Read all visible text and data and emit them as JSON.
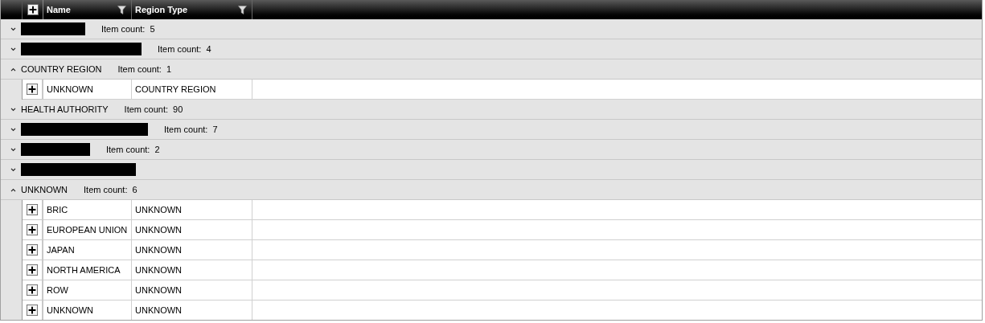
{
  "grid": {
    "columns": [
      {
        "label": "Name"
      },
      {
        "label": "Region Type"
      }
    ],
    "groups": [
      {
        "redacted": true,
        "count": "Item count:  5",
        "expanded": false
      },
      {
        "redacted": true,
        "count": "Item count:  4",
        "expanded": false
      },
      {
        "redacted": false,
        "label": "COUNTRY REGION",
        "count": "Item count:  1",
        "expanded": true,
        "rows": [
          {
            "name": "UNKNOWN",
            "region_type": "COUNTRY REGION"
          }
        ]
      },
      {
        "redacted": false,
        "label": "HEALTH AUTHORITY",
        "count": "Item count:  90",
        "expanded": false
      },
      {
        "redacted": true,
        "count": "Item count:  7",
        "expanded": false
      },
      {
        "redacted": true,
        "count": "Item count:  2",
        "expanded": false
      },
      {
        "redacted": true,
        "expanded": false
      },
      {
        "redacted": false,
        "label": "UNKNOWN",
        "count": "Item count:  6",
        "expanded": true,
        "rows": [
          {
            "name": "BRIC",
            "region_type": "UNKNOWN"
          },
          {
            "name": "EUROPEAN UNION",
            "region_type": "UNKNOWN"
          },
          {
            "name": "JAPAN",
            "region_type": "UNKNOWN"
          },
          {
            "name": "NORTH AMERICA",
            "region_type": "UNKNOWN"
          },
          {
            "name": "ROW",
            "region_type": "UNKNOWN"
          },
          {
            "name": "UNKNOWN",
            "region_type": "UNKNOWN"
          }
        ]
      }
    ]
  }
}
